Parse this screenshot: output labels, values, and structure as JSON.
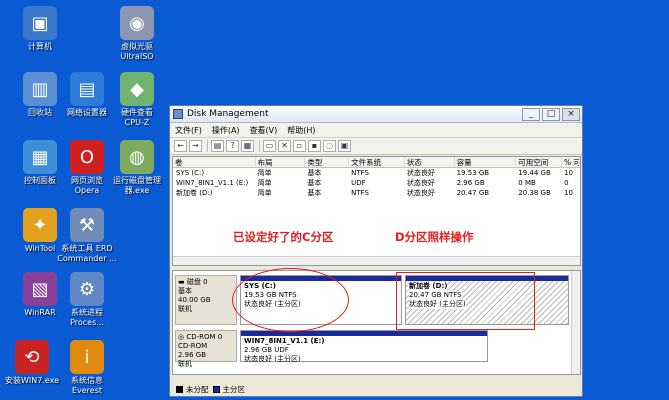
{
  "desktop": {
    "icons": [
      {
        "label": "计算机",
        "icon": "computer-icon",
        "symbol": "▣",
        "color": "#3a77c9"
      },
      {
        "label": "虚拟光驱\nUltraISO",
        "icon": "cd-icon",
        "symbol": "◉",
        "color": "#8c96b0"
      },
      {
        "label": "回收站",
        "icon": "recycle-bin-icon",
        "symbol": "▥",
        "color": "#5a8fd6"
      },
      {
        "label": "网络设置器",
        "icon": "network-icon",
        "symbol": "▤",
        "color": "#2f7bd8"
      },
      {
        "label": "硬件查看\nCPU-Z",
        "icon": "cpu-z-icon",
        "symbol": "◆",
        "color": "#6fb36f"
      },
      {
        "label": "控制面板",
        "icon": "control-panel-icon",
        "symbol": "▦",
        "color": "#3c8fd8"
      },
      {
        "label": "网页浏览\nOpera",
        "icon": "opera-icon",
        "symbol": "O",
        "color": "#d12020"
      },
      {
        "label": "运行磁盘管理\n器.exe",
        "icon": "disk-manager-icon",
        "symbol": "◍",
        "color": "#7fa860"
      },
      {
        "label": "WinTool",
        "icon": "wintool-icon",
        "symbol": "✦",
        "color": "#e3a11d"
      },
      {
        "label": "系统工具 ERD\nCommander ...",
        "icon": "erd-commander-icon",
        "symbol": "⚒",
        "color": "#6f8bb6"
      },
      {
        "label": "WinRAR",
        "icon": "winrar-icon",
        "symbol": "▧",
        "color": "#8a3f9a"
      },
      {
        "label": "系统进程\nProces...",
        "icon": "process-icon",
        "symbol": "⚙",
        "color": "#5f86c5"
      },
      {
        "label": "安装WIN7.exe",
        "icon": "install-win7-icon",
        "symbol": "⟲",
        "color": "#c82424"
      },
      {
        "label": "系统信息\nEverest",
        "icon": "everest-icon",
        "symbol": "i",
        "color": "#e08a10"
      }
    ]
  },
  "window": {
    "title": "Disk Management",
    "menu": [
      "文件(F)",
      "操作(A)",
      "查看(V)",
      "帮助(H)"
    ],
    "title_buttons": [
      "_",
      "□",
      "×"
    ]
  },
  "volume_list": {
    "headers": [
      "卷",
      "布局",
      "类型",
      "文件系统",
      "状态",
      "容量",
      "可用空间",
      "% 可"
    ],
    "rows": [
      [
        "SYS (C:)",
        "简单",
        "基本",
        "NTFS",
        "状态良好",
        "19.53 GB",
        "19.44 GB",
        "10"
      ],
      [
        "WIN7_8IN1_V1.1 (E:)",
        "简单",
        "基本",
        "UDF",
        "状态良好",
        "2.96 GB",
        "0 MB",
        "0"
      ],
      [
        "新加卷 (D:)",
        "简单",
        "基本",
        "NTFS",
        "状态良好",
        "20.47 GB",
        "20.38 GB",
        "10"
      ]
    ]
  },
  "annotations": {
    "left": "已设定好了的C分区",
    "right": "D分区照样操作"
  },
  "disks": {
    "disk0": {
      "name": "磁盘 0",
      "type": "基本",
      "size": "40.00 GB",
      "status": "联机"
    },
    "cdrom0": {
      "name": "CD-ROM 0",
      "type": "CD-ROM",
      "size": "2.96 GB",
      "status": "联机"
    }
  },
  "partitions": {
    "c": {
      "name": "SYS (C:)",
      "info": "19.53 GB NTFS",
      "status": "状态良好 (主分区)"
    },
    "d": {
      "name": "新加卷 (D:)",
      "info": "20.47 GB NTFS",
      "status": "状态良好 (主分区)"
    },
    "e": {
      "name": "WIN7_8IN1_V1.1 (E:)",
      "info": "2.96 GB UDF",
      "status": "状态良好 (主分区)"
    }
  },
  "legend": {
    "unallocated": "未分配",
    "primary": "主分区"
  },
  "colors": {
    "partition_bar": "#1a2a9a",
    "annotation": "#e02020",
    "desktop": "#0a5ad3"
  }
}
